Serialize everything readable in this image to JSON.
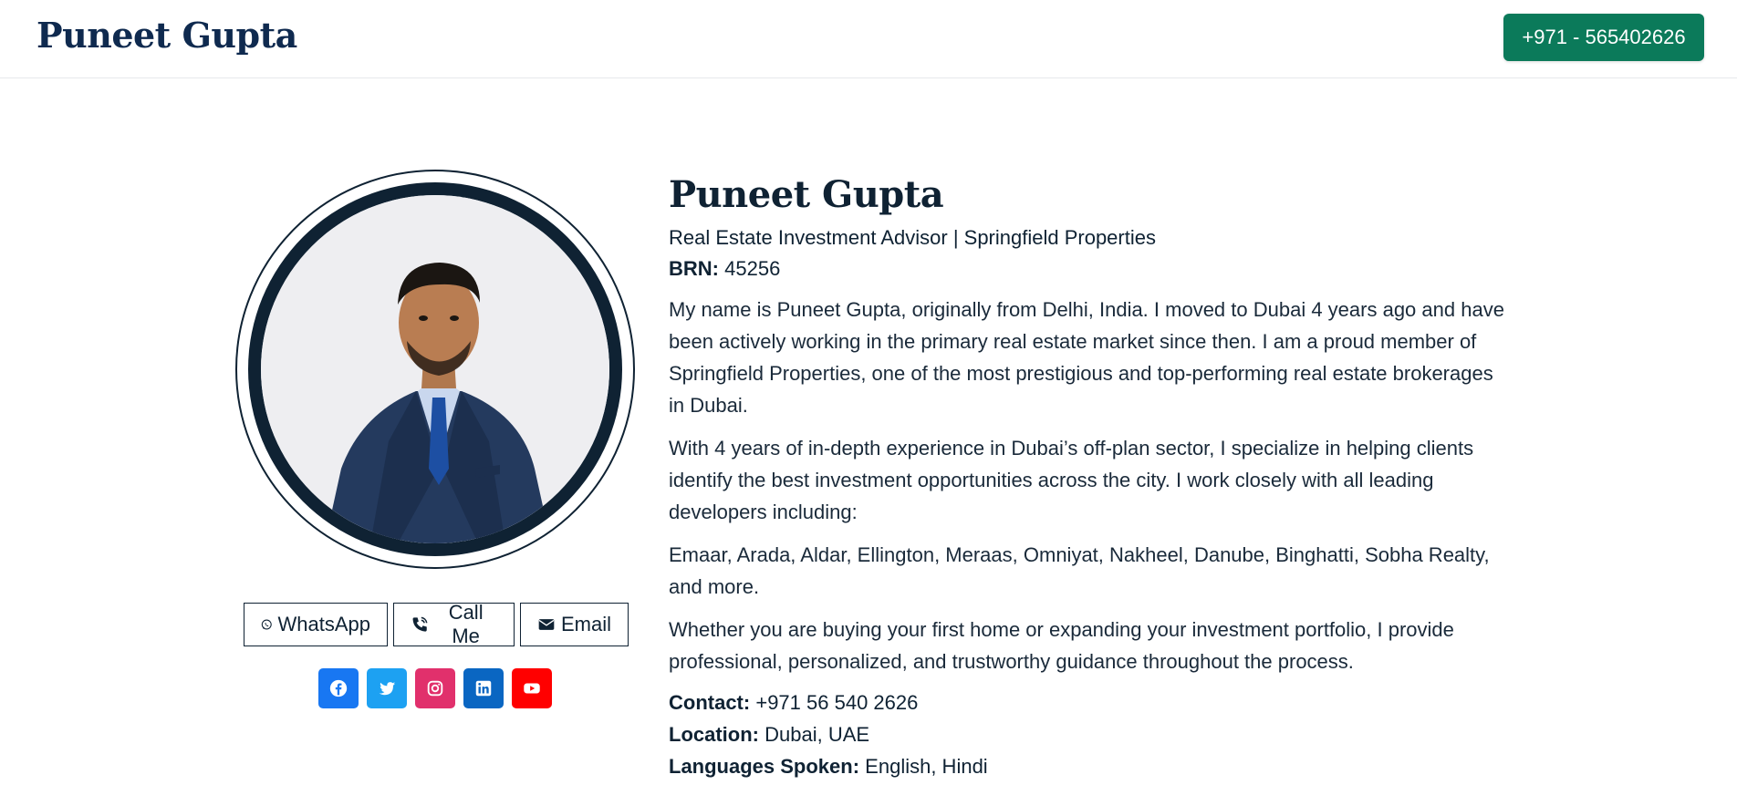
{
  "header": {
    "brand": "Puneet Gupta",
    "phone_button": "+971 - 565402626"
  },
  "profile": {
    "name": "Puneet Gupta",
    "title": "Real Estate Investment Advisor | Springfield Properties",
    "brn_label": "BRN:",
    "brn_value": "45256",
    "paragraphs": [
      "My name is Puneet Gupta, originally from Delhi, India. I moved to Dubai 4 years ago and have been actively working in the primary real estate market since then. I am a proud member of Springfield Properties, one of the most prestigious and top-performing real estate brokerages in Dubai.",
      "With 4 years of in-depth experience in Dubai’s off-plan sector, I specialize in helping clients identify the best investment opportunities across the city. I work closely with all leading developers including:",
      "Emaar, Arada, Aldar, Ellington, Meraas, Omniyat, Nakheel, Danube, Binghatti, Sobha Realty, and more.",
      "Whether you are buying your first home or expanding your investment portfolio, I provide professional, personalized, and trustworthy guidance throughout the process."
    ],
    "contact_label": "Contact:",
    "contact_value": "+971 56 540 2626",
    "location_label": "Location:",
    "location_value": "Dubai, UAE",
    "languages_label": "Languages Spoken:",
    "languages_value": "English, Hindi"
  },
  "contact_buttons": {
    "whatsapp": "WhatsApp",
    "call": "Call Me",
    "email": "Email"
  },
  "socials": [
    {
      "name": "facebook-icon",
      "color": "#1877f2"
    },
    {
      "name": "twitter-icon",
      "color": "#1da1f2"
    },
    {
      "name": "instagram-icon",
      "color": "#e1306c"
    },
    {
      "name": "linkedin-icon",
      "color": "#0a66c2"
    },
    {
      "name": "youtube-icon",
      "color": "#ff0000"
    }
  ],
  "colors": {
    "brand_navy": "#0f2a4f",
    "primary_green": "#0b7a5a",
    "text_dark": "#0f2233"
  }
}
